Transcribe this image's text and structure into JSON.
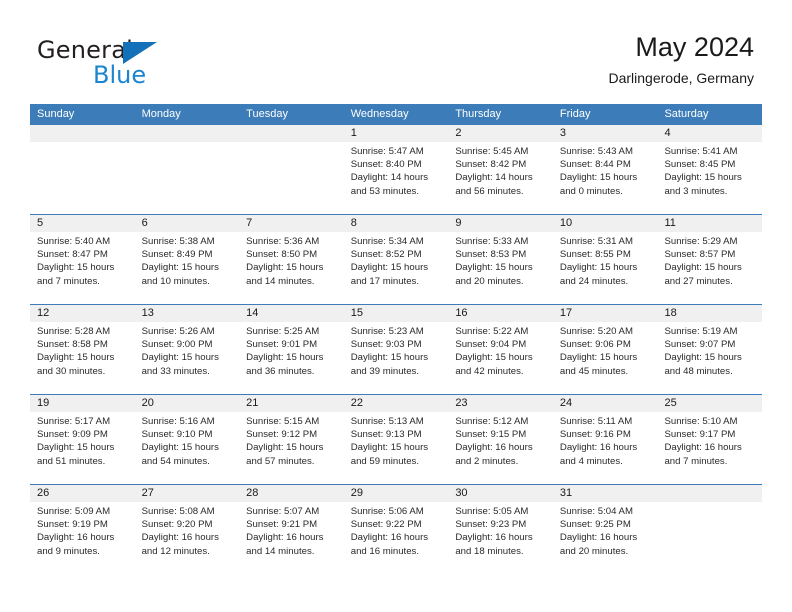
{
  "brand": {
    "name_primary": "General",
    "name_secondary": "Blue",
    "triangle_color": "#1271b8",
    "blue_text_color": "#1b85d0"
  },
  "header": {
    "title": "May 2024",
    "subtitle": "Darlingerode, Germany"
  },
  "theme": {
    "header_bg": "#3c7cb8",
    "header_text": "#ffffff",
    "daynum_band_bg": "#f0f0f0",
    "cell_bg": "#ffffff",
    "separator": "#3c7cb8"
  },
  "weekdays": [
    "Sunday",
    "Monday",
    "Tuesday",
    "Wednesday",
    "Thursday",
    "Friday",
    "Saturday"
  ],
  "weeks": [
    [
      {
        "day": "",
        "lines": []
      },
      {
        "day": "",
        "lines": []
      },
      {
        "day": "",
        "lines": []
      },
      {
        "day": "1",
        "lines": [
          "Sunrise: 5:47 AM",
          "Sunset: 8:40 PM",
          "Daylight: 14 hours",
          "and 53 minutes."
        ]
      },
      {
        "day": "2",
        "lines": [
          "Sunrise: 5:45 AM",
          "Sunset: 8:42 PM",
          "Daylight: 14 hours",
          "and 56 minutes."
        ]
      },
      {
        "day": "3",
        "lines": [
          "Sunrise: 5:43 AM",
          "Sunset: 8:44 PM",
          "Daylight: 15 hours",
          "and 0 minutes."
        ]
      },
      {
        "day": "4",
        "lines": [
          "Sunrise: 5:41 AM",
          "Sunset: 8:45 PM",
          "Daylight: 15 hours",
          "and 3 minutes."
        ]
      }
    ],
    [
      {
        "day": "5",
        "lines": [
          "Sunrise: 5:40 AM",
          "Sunset: 8:47 PM",
          "Daylight: 15 hours",
          "and 7 minutes."
        ]
      },
      {
        "day": "6",
        "lines": [
          "Sunrise: 5:38 AM",
          "Sunset: 8:49 PM",
          "Daylight: 15 hours",
          "and 10 minutes."
        ]
      },
      {
        "day": "7",
        "lines": [
          "Sunrise: 5:36 AM",
          "Sunset: 8:50 PM",
          "Daylight: 15 hours",
          "and 14 minutes."
        ]
      },
      {
        "day": "8",
        "lines": [
          "Sunrise: 5:34 AM",
          "Sunset: 8:52 PM",
          "Daylight: 15 hours",
          "and 17 minutes."
        ]
      },
      {
        "day": "9",
        "lines": [
          "Sunrise: 5:33 AM",
          "Sunset: 8:53 PM",
          "Daylight: 15 hours",
          "and 20 minutes."
        ]
      },
      {
        "day": "10",
        "lines": [
          "Sunrise: 5:31 AM",
          "Sunset: 8:55 PM",
          "Daylight: 15 hours",
          "and 24 minutes."
        ]
      },
      {
        "day": "11",
        "lines": [
          "Sunrise: 5:29 AM",
          "Sunset: 8:57 PM",
          "Daylight: 15 hours",
          "and 27 minutes."
        ]
      }
    ],
    [
      {
        "day": "12",
        "lines": [
          "Sunrise: 5:28 AM",
          "Sunset: 8:58 PM",
          "Daylight: 15 hours",
          "and 30 minutes."
        ]
      },
      {
        "day": "13",
        "lines": [
          "Sunrise: 5:26 AM",
          "Sunset: 9:00 PM",
          "Daylight: 15 hours",
          "and 33 minutes."
        ]
      },
      {
        "day": "14",
        "lines": [
          "Sunrise: 5:25 AM",
          "Sunset: 9:01 PM",
          "Daylight: 15 hours",
          "and 36 minutes."
        ]
      },
      {
        "day": "15",
        "lines": [
          "Sunrise: 5:23 AM",
          "Sunset: 9:03 PM",
          "Daylight: 15 hours",
          "and 39 minutes."
        ]
      },
      {
        "day": "16",
        "lines": [
          "Sunrise: 5:22 AM",
          "Sunset: 9:04 PM",
          "Daylight: 15 hours",
          "and 42 minutes."
        ]
      },
      {
        "day": "17",
        "lines": [
          "Sunrise: 5:20 AM",
          "Sunset: 9:06 PM",
          "Daylight: 15 hours",
          "and 45 minutes."
        ]
      },
      {
        "day": "18",
        "lines": [
          "Sunrise: 5:19 AM",
          "Sunset: 9:07 PM",
          "Daylight: 15 hours",
          "and 48 minutes."
        ]
      }
    ],
    [
      {
        "day": "19",
        "lines": [
          "Sunrise: 5:17 AM",
          "Sunset: 9:09 PM",
          "Daylight: 15 hours",
          "and 51 minutes."
        ]
      },
      {
        "day": "20",
        "lines": [
          "Sunrise: 5:16 AM",
          "Sunset: 9:10 PM",
          "Daylight: 15 hours",
          "and 54 minutes."
        ]
      },
      {
        "day": "21",
        "lines": [
          "Sunrise: 5:15 AM",
          "Sunset: 9:12 PM",
          "Daylight: 15 hours",
          "and 57 minutes."
        ]
      },
      {
        "day": "22",
        "lines": [
          "Sunrise: 5:13 AM",
          "Sunset: 9:13 PM",
          "Daylight: 15 hours",
          "and 59 minutes."
        ]
      },
      {
        "day": "23",
        "lines": [
          "Sunrise: 5:12 AM",
          "Sunset: 9:15 PM",
          "Daylight: 16 hours",
          "and 2 minutes."
        ]
      },
      {
        "day": "24",
        "lines": [
          "Sunrise: 5:11 AM",
          "Sunset: 9:16 PM",
          "Daylight: 16 hours",
          "and 4 minutes."
        ]
      },
      {
        "day": "25",
        "lines": [
          "Sunrise: 5:10 AM",
          "Sunset: 9:17 PM",
          "Daylight: 16 hours",
          "and 7 minutes."
        ]
      }
    ],
    [
      {
        "day": "26",
        "lines": [
          "Sunrise: 5:09 AM",
          "Sunset: 9:19 PM",
          "Daylight: 16 hours",
          "and 9 minutes."
        ]
      },
      {
        "day": "27",
        "lines": [
          "Sunrise: 5:08 AM",
          "Sunset: 9:20 PM",
          "Daylight: 16 hours",
          "and 12 minutes."
        ]
      },
      {
        "day": "28",
        "lines": [
          "Sunrise: 5:07 AM",
          "Sunset: 9:21 PM",
          "Daylight: 16 hours",
          "and 14 minutes."
        ]
      },
      {
        "day": "29",
        "lines": [
          "Sunrise: 5:06 AM",
          "Sunset: 9:22 PM",
          "Daylight: 16 hours",
          "and 16 minutes."
        ]
      },
      {
        "day": "30",
        "lines": [
          "Sunrise: 5:05 AM",
          "Sunset: 9:23 PM",
          "Daylight: 16 hours",
          "and 18 minutes."
        ]
      },
      {
        "day": "31",
        "lines": [
          "Sunrise: 5:04 AM",
          "Sunset: 9:25 PM",
          "Daylight: 16 hours",
          "and 20 minutes."
        ]
      },
      {
        "day": "",
        "lines": []
      }
    ]
  ]
}
